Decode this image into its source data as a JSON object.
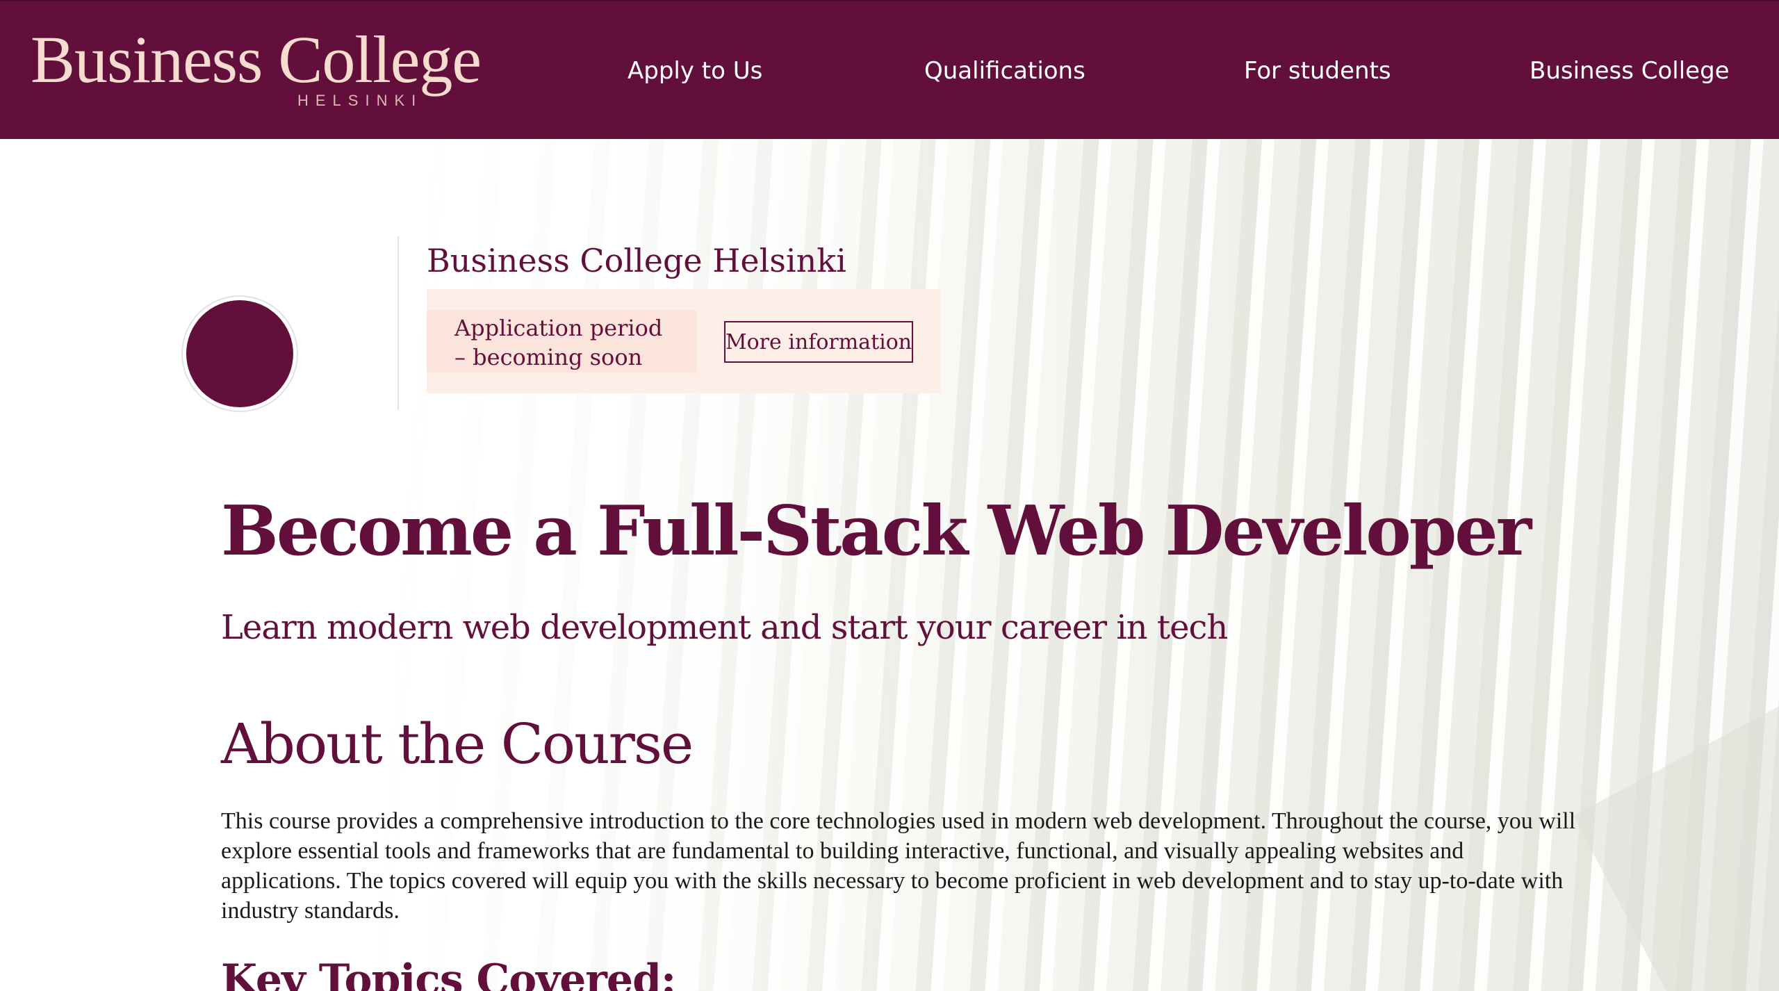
{
  "header": {
    "logo_main": "Business College",
    "logo_sub": "HELSINKI",
    "nav": [
      {
        "label": "Apply to Us"
      },
      {
        "label": "Qualifications"
      },
      {
        "label": "For students"
      },
      {
        "label": "Business College"
      }
    ]
  },
  "widget": {
    "title": "Business College Helsinki",
    "period_line1": "Application period",
    "period_line2": "– becoming soon",
    "more_button": "More information"
  },
  "main": {
    "title": "Become a Full-Stack Web Developer",
    "subtitle": "Learn modern web development and start your career in tech",
    "about_heading": "About the Course",
    "about_body": "This course provides a comprehensive introduction to the core technologies used in modern web development. Throughout the course, you will explore essential tools and frameworks that are fundamental to building interactive, functional, and visually appealing websites and applications. The topics covered will equip you with the skills necessary to become proficient in web development and to stay up-to-date with industry standards.",
    "topics_heading": "Key Topics Covered:"
  },
  "colors": {
    "brand": "#62103b",
    "logo_text": "#f6dccf",
    "widget_background": "#fdeee8",
    "period_background": "#fbe4dc"
  }
}
